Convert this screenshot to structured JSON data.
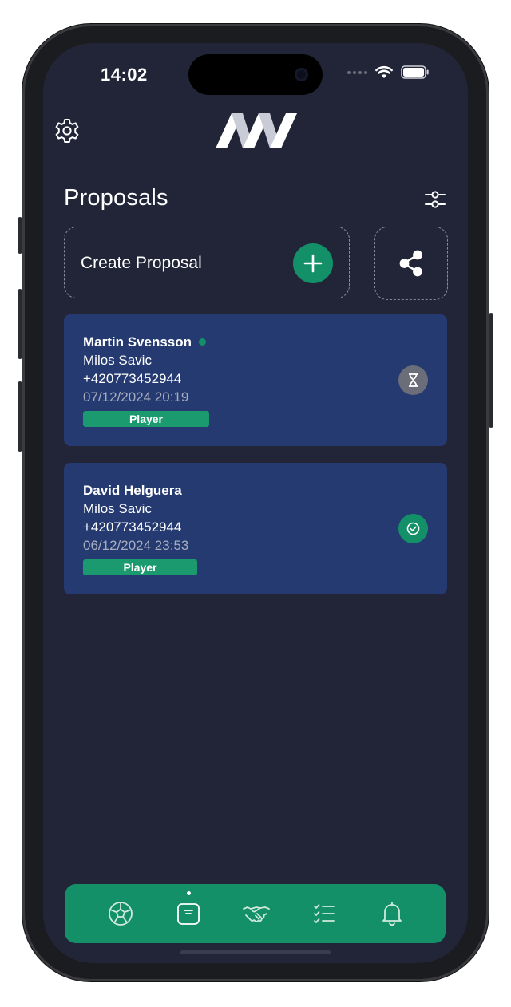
{
  "status_bar": {
    "time": "14:02"
  },
  "header": {
    "settings_icon": "gear-icon",
    "logo_icon": "brand-logo-icon"
  },
  "page": {
    "title": "Proposals",
    "filter_icon": "sliders-icon"
  },
  "actions": {
    "create_label": "Create Proposal",
    "create_icon": "plus-icon",
    "share_icon": "share-icon"
  },
  "proposals": [
    {
      "name": "Martin Svensson",
      "online": true,
      "agent": "Milos Savic",
      "phone": "+420773452944",
      "date": "07/12/2024 20:19",
      "badge": "Player",
      "status_icon": "hourglass-icon",
      "status_color": "#6b6d78"
    },
    {
      "name": "David Helguera",
      "online": false,
      "agent": "Milos Savic",
      "phone": "+420773452944",
      "date": "06/12/2024 23:53",
      "badge": "Player",
      "status_icon": "check-circle-icon",
      "status_color": "#139068"
    }
  ],
  "tabbar": {
    "items": [
      {
        "icon": "football-icon",
        "active": false
      },
      {
        "icon": "document-icon",
        "active": true
      },
      {
        "icon": "handshake-icon",
        "active": false
      },
      {
        "icon": "checklist-icon",
        "active": false
      },
      {
        "icon": "bell-icon",
        "active": false
      }
    ]
  },
  "colors": {
    "background": "#222538",
    "card": "#243a70",
    "accent": "#139068",
    "text_muted": "#a8adbd"
  }
}
